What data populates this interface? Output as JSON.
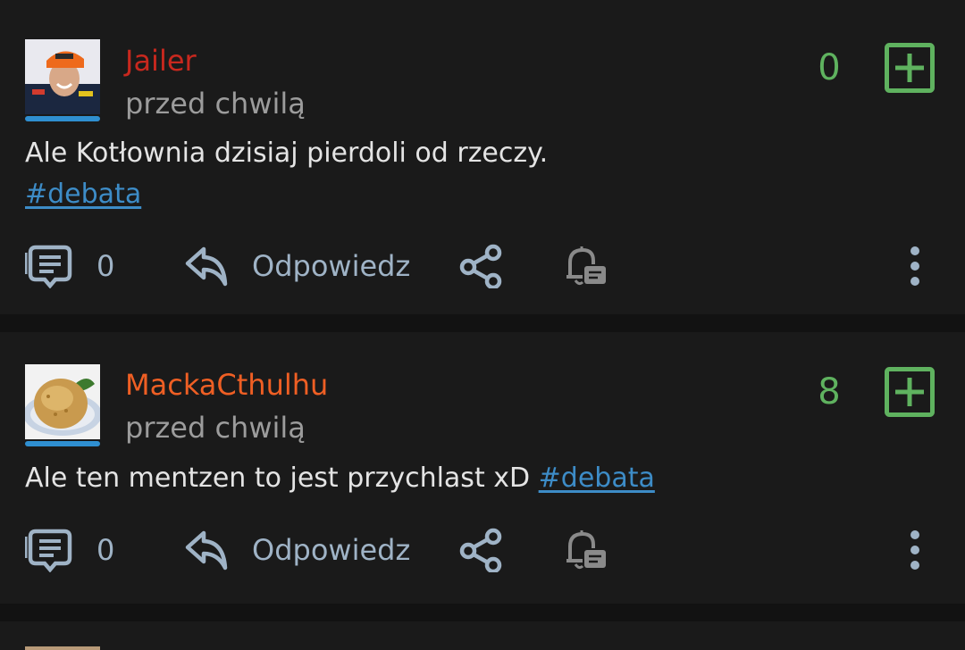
{
  "posts": [
    {
      "username": "Jailer",
      "username_color": "#c8281e",
      "timestamp": "przed chwilą",
      "content_text": "Ale Kotłownia dzisiaj pierdoli od rzeczy.",
      "tag": "#debata",
      "score": "0",
      "comment_count": "0",
      "reply_label": "Odpowiedz"
    },
    {
      "username": "MackaCthulhu",
      "username_color": "#ef5f24",
      "timestamp": "przed chwilą",
      "content_text": "Ale ten mentzen to jest przychlast xD ",
      "tag": "#debata",
      "score": "8",
      "comment_count": "0",
      "reply_label": "Odpowiedz"
    }
  ],
  "colors": {
    "background": "#121212",
    "card": "#1a1a1a",
    "accent_green": "#5fb25f",
    "link_blue": "#3d8cc7",
    "icon_gray_blue": "#9fb3c6"
  },
  "icons": [
    "comment-icon",
    "reply-icon",
    "share-icon",
    "notification-bell-icon",
    "more-vertical-icon",
    "plus-vote-icon"
  ]
}
